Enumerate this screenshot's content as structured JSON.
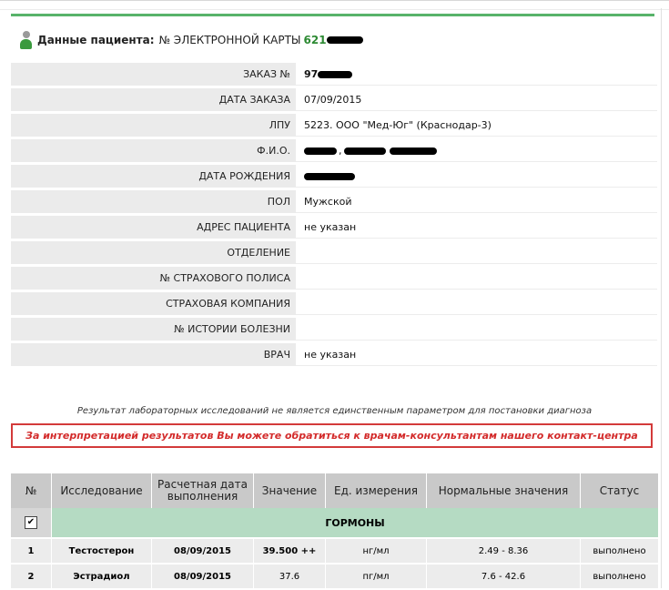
{
  "header": {
    "title": "Данные пациента:",
    "card_label": "№ ЭЛЕКТРОННОЙ КАРТЫ",
    "card_number": "621"
  },
  "info": {
    "order_label": "ЗАКАЗ №",
    "order_value": "97",
    "order_date_label": "ДАТА ЗАКАЗА",
    "order_date_value": "07/09/2015",
    "lpu_label": "ЛПУ",
    "lpu_value": "5223. ООО \"Мед-Юг\" (Краснодар-3)",
    "fio_label": "Ф.И.О.",
    "fio_value": "",
    "birth_label": "ДАТА РОЖДЕНИЯ",
    "birth_value": "",
    "sex_label": "ПОЛ",
    "sex_value": "Мужской",
    "address_label": "АДРЕС ПАЦИЕНТА",
    "address_value": "не указан",
    "dept_label": "ОТДЕЛЕНИЕ",
    "dept_value": "",
    "policy_label": "№ СТРАХОВОГО ПОЛИСА",
    "policy_value": "",
    "insurer_label": "СТРАХОВАЯ КОМПАНИЯ",
    "insurer_value": "",
    "history_label": "№ ИСТОРИИ БОЛЕЗНИ",
    "history_value": "",
    "doctor_label": "ВРАЧ",
    "doctor_value": "не указан"
  },
  "disclaimer": "Результат лабораторных исследований не является единственным параметром для постановки диагноза",
  "warning": "За интерпретацией результатов Вы можете обратиться к врачам-консультантам нашего контакт-центра",
  "results": {
    "headers": {
      "num": "№",
      "test": "Исследование",
      "date": "Расчетная дата выполнения",
      "value": "Значение",
      "unit": "Ед. измерения",
      "norm": "Нормальные значения",
      "status": "Статус"
    },
    "group": {
      "checkbox": "✔",
      "name": "ГОРМОНЫ"
    },
    "rows": [
      {
        "num": "1",
        "test": "Тестостерон",
        "date": "08/09/2015",
        "value": "39.500 ++",
        "unit": "нг/мл",
        "norm": "2.49 - 8.36",
        "status": "выполнено"
      },
      {
        "num": "2",
        "test": "Эстрадиол",
        "date": "08/09/2015",
        "value": "37.6",
        "unit": "пг/мл",
        "norm": "7.6 - 42.6",
        "status": "выполнено"
      }
    ]
  }
}
